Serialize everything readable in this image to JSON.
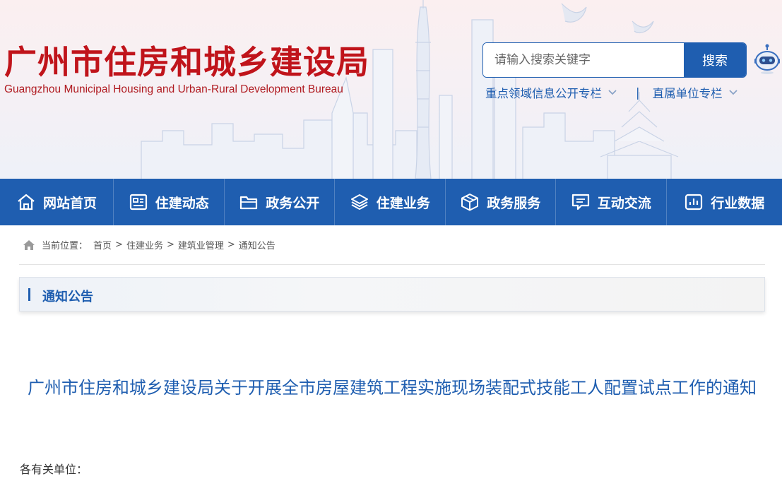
{
  "header": {
    "title": "广州市住房和城乡建设局",
    "subtitle": "Guangzhou Municipal Housing and Urban-Rural Development Bureau",
    "search": {
      "placeholder": "请输入搜索关键字",
      "button_label": "搜索"
    },
    "robot_icon": "robot-assistant-icon",
    "quick_links": [
      {
        "label": "重点领域信息公开专栏",
        "icon": "chevron-down-icon"
      },
      {
        "label": "直属单位专栏",
        "icon": "chevron-down-icon"
      }
    ],
    "separator": "|"
  },
  "nav": {
    "items": [
      {
        "label": "网站首页",
        "icon": "home-icon"
      },
      {
        "label": "住建动态",
        "icon": "news-icon"
      },
      {
        "label": "政务公开",
        "icon": "folder-icon"
      },
      {
        "label": "住建业务",
        "icon": "layers-icon"
      },
      {
        "label": "政务服务",
        "icon": "cube-icon"
      },
      {
        "label": "互动交流",
        "icon": "chat-icon"
      },
      {
        "label": "行业数据",
        "icon": "bar-chart-icon"
      }
    ]
  },
  "breadcrumb": {
    "prefix": "当前位置：",
    "items": [
      "首页",
      "住建业务",
      "建筑业管理",
      "通知公告"
    ],
    "separator": ">"
  },
  "section": {
    "title": "通知公告"
  },
  "article": {
    "title": "广州市住房和城乡建设局关于开展全市房屋建筑工程实施现场装配式技能工人配置试点工作的通知",
    "salutation": "各有关单位："
  },
  "colors": {
    "brand_blue": "#1f5eb0",
    "title_red": "#c0141b"
  }
}
